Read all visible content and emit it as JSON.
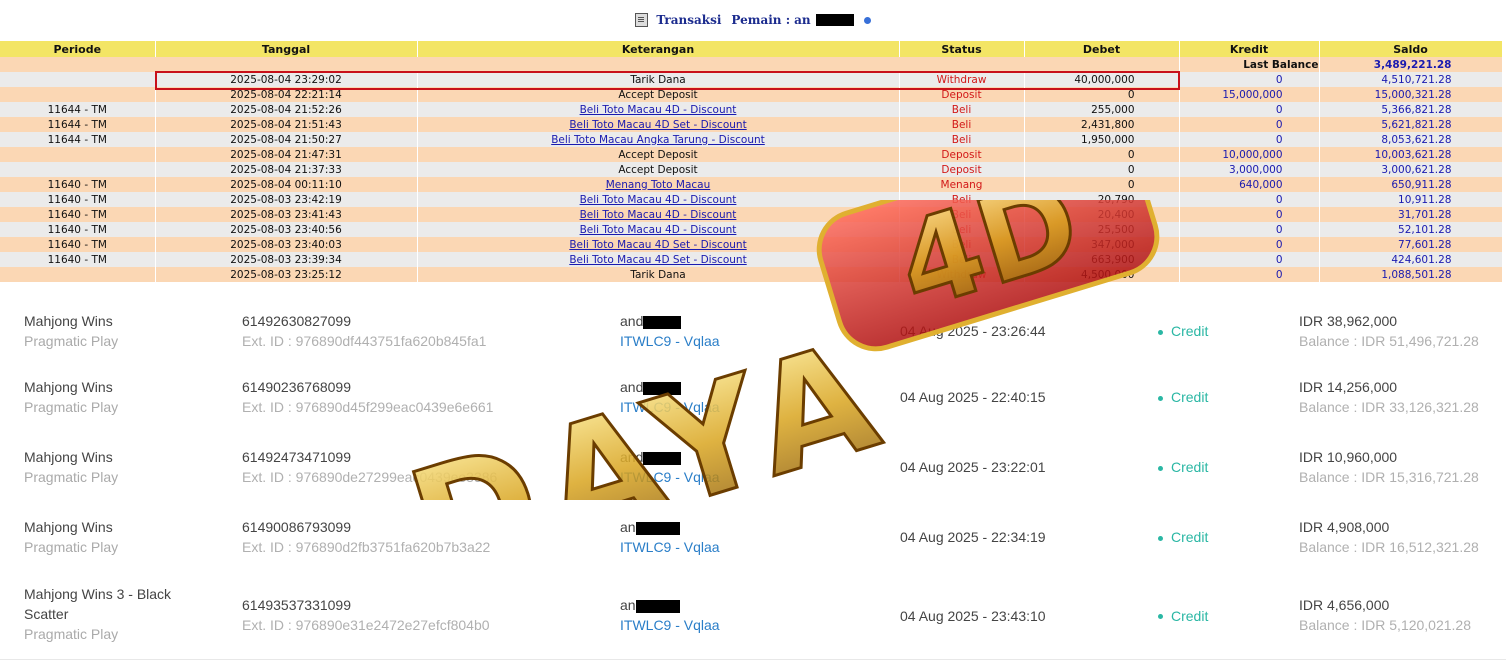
{
  "header": {
    "title_prefix": "Transaksi",
    "title_label": "Pemain :",
    "player_visible": "an"
  },
  "table": {
    "columns": [
      "Periode",
      "Tanggal",
      "Keterangan",
      "Status",
      "Debet",
      "Kredit",
      "Saldo"
    ],
    "last_balance_label": "Last Balance",
    "last_balance_value": "3,489,221.28",
    "rows": [
      {
        "periode": "",
        "tanggal": "2025-08-04 23:29:02",
        "keterangan": "Tarik Dana",
        "link": false,
        "status": "Withdraw",
        "debet": "40,000,000",
        "kredit": "0",
        "saldo": "4,510,721.28"
      },
      {
        "periode": "",
        "tanggal": "2025-08-04 22:21:14",
        "keterangan": "Accept Deposit",
        "link": false,
        "status": "Deposit",
        "debet": "0",
        "kredit": "15,000,000",
        "saldo": "15,000,321.28"
      },
      {
        "periode": "11644 - TM",
        "tanggal": "2025-08-04 21:52:26",
        "keterangan": "Beli Toto Macau 4D - Discount",
        "link": true,
        "status": "Beli",
        "debet": "255,000",
        "kredit": "0",
        "saldo": "5,366,821.28"
      },
      {
        "periode": "11644 - TM",
        "tanggal": "2025-08-04 21:51:43",
        "keterangan": "Beli Toto Macau 4D Set - Discount",
        "link": true,
        "status": "Beli",
        "debet": "2,431,800",
        "kredit": "0",
        "saldo": "5,621,821.28"
      },
      {
        "periode": "11644 - TM",
        "tanggal": "2025-08-04 21:50:27",
        "keterangan": "Beli Toto Macau Angka Tarung - Discount",
        "link": true,
        "status": "Beli",
        "debet": "1,950,000",
        "kredit": "0",
        "saldo": "8,053,621.28"
      },
      {
        "periode": "",
        "tanggal": "2025-08-04 21:47:31",
        "keterangan": "Accept Deposit",
        "link": false,
        "status": "Deposit",
        "debet": "0",
        "kredit": "10,000,000",
        "saldo": "10,003,621.28"
      },
      {
        "periode": "",
        "tanggal": "2025-08-04 21:37:33",
        "keterangan": "Accept Deposit",
        "link": false,
        "status": "Deposit",
        "debet": "0",
        "kredit": "3,000,000",
        "saldo": "3,000,621.28"
      },
      {
        "periode": "11640 - TM",
        "tanggal": "2025-08-04 00:11:10",
        "keterangan": "Menang Toto Macau",
        "link": true,
        "status": "Menang",
        "debet": "0",
        "kredit": "640,000",
        "saldo": "650,911.28"
      },
      {
        "periode": "11640 - TM",
        "tanggal": "2025-08-03 23:42:19",
        "keterangan": "Beli Toto Macau 4D - Discount",
        "link": true,
        "status": "Beli",
        "debet": "20,790",
        "kredit": "0",
        "saldo": "10,911.28"
      },
      {
        "periode": "11640 - TM",
        "tanggal": "2025-08-03 23:41:43",
        "keterangan": "Beli Toto Macau 4D - Discount",
        "link": true,
        "status": "Beli",
        "debet": "20,400",
        "kredit": "0",
        "saldo": "31,701.28"
      },
      {
        "periode": "11640 - TM",
        "tanggal": "2025-08-03 23:40:56",
        "keterangan": "Beli Toto Macau 4D - Discount",
        "link": true,
        "status": "Beli",
        "debet": "25,500",
        "kredit": "0",
        "saldo": "52,101.28"
      },
      {
        "periode": "11640 - TM",
        "tanggal": "2025-08-03 23:40:03",
        "keterangan": "Beli Toto Macau 4D Set - Discount",
        "link": true,
        "status": "Beli",
        "debet": "347,000",
        "kredit": "0",
        "saldo": "77,601.28"
      },
      {
        "periode": "11640 - TM",
        "tanggal": "2025-08-03 23:39:34",
        "keterangan": "Beli Toto Macau 4D Set - Discount",
        "link": true,
        "status": "Beli",
        "debet": "663,900",
        "kredit": "0",
        "saldo": "424,601.28"
      },
      {
        "periode": "",
        "tanggal": "2025-08-03 23:25:12",
        "keterangan": "Tarik Dana",
        "link": false,
        "status": "Withdraw",
        "debet": "4,500,000",
        "kredit": "0",
        "saldo": "1,088,501.28"
      }
    ]
  },
  "games": [
    {
      "game": "Mahjong Wins",
      "provider": "Pragmatic Play",
      "id": "61492630827099",
      "ext": "Ext. ID : 976890df443751fa620b845fa1",
      "user": "and",
      "agent": "ITWLC9 - Vqlaa",
      "date": "04 Aug 2025 - 23:26:44",
      "type": "Credit",
      "amount": "IDR 38,962,000",
      "balance": "Balance : IDR 51,496,721.28"
    },
    {
      "game": "Mahjong Wins",
      "provider": "Pragmatic Play",
      "id": "61490236768099",
      "ext": "Ext. ID : 976890d45f299eac0439e6e661",
      "user": "and",
      "agent": "ITWLC9 - Vqlaa",
      "date": "04 Aug 2025 - 22:40:15",
      "type": "Credit",
      "amount": "IDR 14,256,000",
      "balance": "Balance : IDR 33,126,321.28"
    },
    {
      "game": "Mahjong Wins",
      "provider": "Pragmatic Play",
      "id": "61492473471099",
      "ext": "Ext. ID : 976890de27299eac0439ee3386",
      "user": "and",
      "agent": "ITWLC9 - Vqlaa",
      "date": "04 Aug 2025 - 23:22:01",
      "type": "Credit",
      "amount": "IDR 10,960,000",
      "balance": "Balance : IDR 15,316,721.28"
    },
    {
      "game": "Mahjong Wins",
      "provider": "Pragmatic Play",
      "id": "61490086793099",
      "ext": "Ext. ID : 976890d2fb3751fa620b7b3a22",
      "user": "an",
      "agent": "ITWLC9 - Vqlaa",
      "date": "04 Aug 2025 - 22:34:19",
      "type": "Credit",
      "amount": "IDR 4,908,000",
      "balance": "Balance : IDR 16,512,321.28"
    },
    {
      "game": "Mahjong Wins 3 - Black Scatter",
      "provider": "Pragmatic Play",
      "id": "61493537331099",
      "ext": "Ext. ID : 976890e31e2472e27efcf804b0",
      "user": "an",
      "agent": "ITWLC9 - Vqlaa",
      "date": "04 Aug 2025 - 23:43:10",
      "type": "Credit",
      "amount": "IDR 4,656,000",
      "balance": "Balance : IDR 5,120,021.28"
    }
  ],
  "watermark": {
    "text_left": "DAYA",
    "text_right": "4D"
  },
  "colors": {
    "header_yellow": "#f3e565",
    "row_peach": "#fbd7b4",
    "row_grey": "#ebebeb",
    "status_red": "#d21818",
    "link_blue": "#1a1ab0",
    "credit_teal": "#2ab7a4",
    "agent_blue": "#2a7ec8"
  }
}
